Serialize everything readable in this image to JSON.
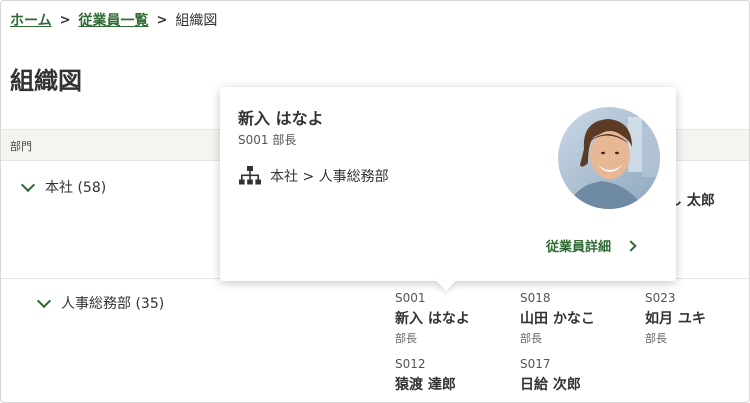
{
  "breadcrumb": {
    "home": "ホーム",
    "list": "従業員一覧",
    "current": "組織図",
    "sep": ">"
  },
  "page": {
    "title": "組織図"
  },
  "table": {
    "dept_header": "部門"
  },
  "departments": [
    {
      "label": "本社 (58)"
    },
    {
      "label": "人事総務部 (35)"
    }
  ],
  "partial_name": "し 太郎",
  "employees": [
    {
      "code": "S001",
      "name": "新入 はなよ",
      "role": "部長"
    },
    {
      "code": "S018",
      "name": "山田 かなこ",
      "role": "部長"
    },
    {
      "code": "S023",
      "name": "如月 ユキ",
      "role": "部長"
    },
    {
      "code": "S012",
      "name": "猿渡 達郎",
      "role": ""
    },
    {
      "code": "S017",
      "name": "日給 次郎",
      "role": ""
    }
  ],
  "popup": {
    "name": "新入 はなよ",
    "meta": "S001 部長",
    "org_path": "本社 > 人事総務部",
    "org_icon": "org-chart-icon",
    "detail_link": "従業員詳細"
  },
  "colors": {
    "accent": "#2f6a33",
    "header_bg": "#f5f4f1"
  }
}
